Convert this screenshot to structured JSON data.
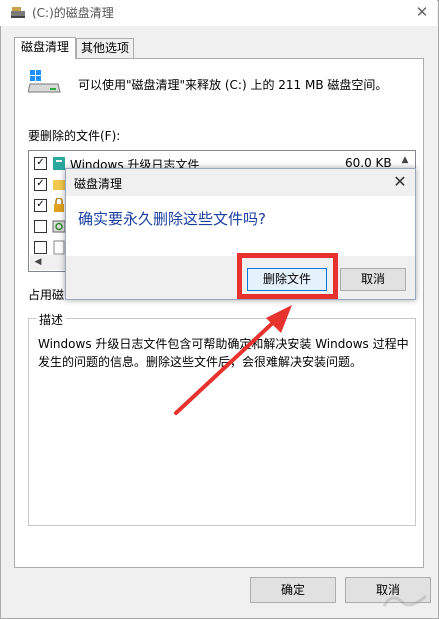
{
  "window": {
    "title": "(C:)的磁盘清理",
    "close_glyph": "✕"
  },
  "tabs": [
    {
      "label": "磁盘清理",
      "active": true
    },
    {
      "label": "其他选项",
      "active": false
    }
  ],
  "summary": {
    "text": "可以使用\"磁盘清理\"来释放 (C:) 上的 211 MB 磁盘空间。"
  },
  "files": {
    "label": "要删除的文件(F):",
    "items": [
      {
        "checked": true,
        "name": "Windows 升级日志文件",
        "size": "60.0 KB",
        "icon": "log-file-icon"
      },
      {
        "checked": true,
        "name": "",
        "size": "",
        "icon": "folder-icon"
      },
      {
        "checked": true,
        "name": "",
        "size": "",
        "icon": "lock-icon"
      },
      {
        "checked": false,
        "name": "",
        "size": "",
        "icon": "recycle-icon"
      },
      {
        "checked": false,
        "name": "",
        "size": "",
        "icon": "document-icon"
      }
    ]
  },
  "usage_label": "占用磁",
  "description": {
    "title": "描述",
    "text": "Windows 升级日志文件包含可帮助确定和解决安装 Windows 过程中发生的问题的信息。删除这些文件后，会很难解决安装问题。"
  },
  "buttons": {
    "ok": "确定",
    "cancel": "取消"
  },
  "dialog": {
    "title": "磁盘清理",
    "message": "确实要永久删除这些文件吗?",
    "delete_label": "删除文件",
    "cancel_label": "取消",
    "close_glyph": "✕"
  },
  "colors": {
    "annotation": "#e8322e",
    "message": "#1a3fa0",
    "focus": "#0078d7"
  }
}
